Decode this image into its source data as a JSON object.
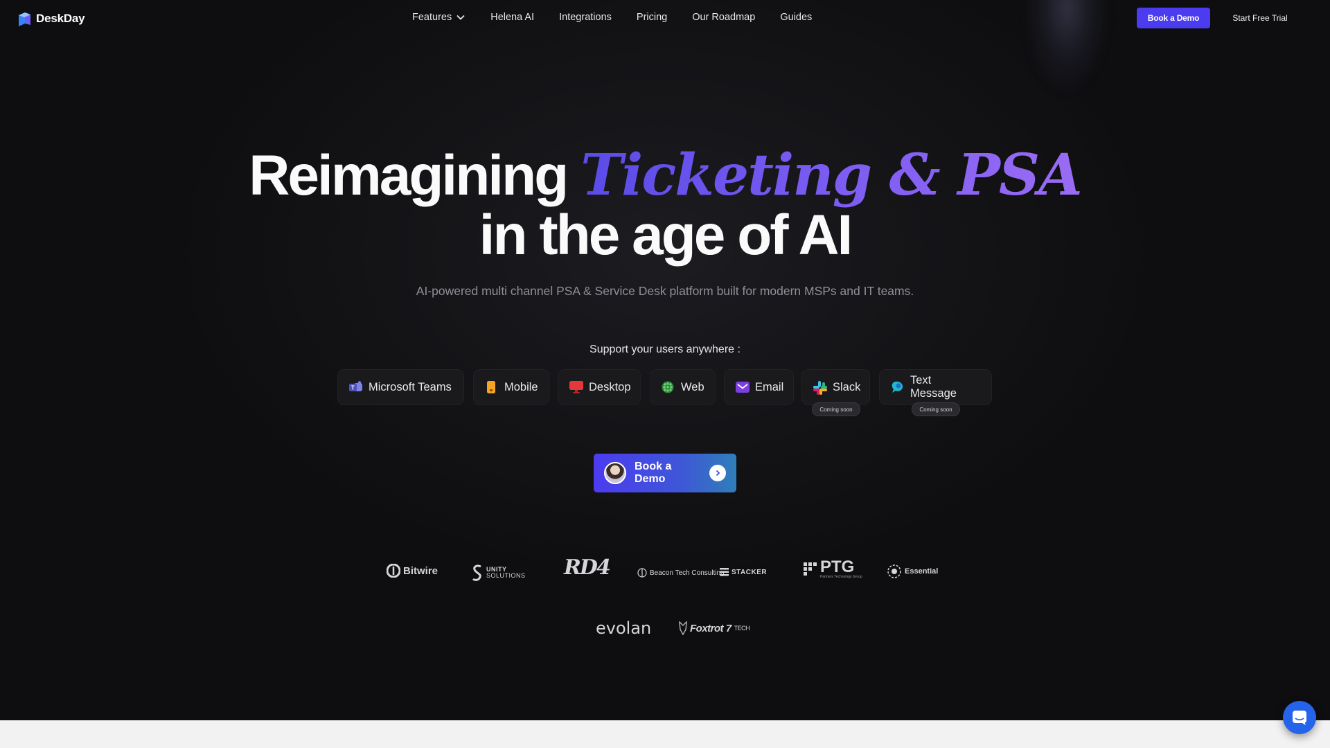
{
  "brand": {
    "name": "DeskDay"
  },
  "nav": {
    "links": [
      {
        "label": "Features"
      },
      {
        "label": "Helena AI"
      },
      {
        "label": "Integrations"
      },
      {
        "label": "Pricing"
      },
      {
        "label": "Our Roadmap"
      },
      {
        "label": "Guides"
      }
    ],
    "book_demo": "Book a Demo",
    "start_trial": "Start Free Trial"
  },
  "hero": {
    "headline_part1": "Reimagining",
    "headline_accent": "Ticketing & PSA",
    "headline_line2": "in the age of AI",
    "subtitle": "AI-powered multi channel PSA & Service Desk platform built for modern MSPs and IT teams.",
    "support_label": "Support your users anywhere :"
  },
  "channels": [
    {
      "label": "Microsoft Teams",
      "icon": "microsoft-teams-icon",
      "color": "#5b5fc7"
    },
    {
      "label": "Mobile",
      "icon": "mobile-icon",
      "color": "#f5a524"
    },
    {
      "label": "Desktop",
      "icon": "desktop-icon",
      "color": "#e5383b"
    },
    {
      "label": "Web",
      "icon": "web-icon",
      "color": "#3fa34d"
    },
    {
      "label": "Email",
      "icon": "email-icon",
      "color": "#7b3fe4"
    },
    {
      "label": "Slack",
      "icon": "slack-icon",
      "badge": "Coming soon"
    },
    {
      "label": "Text Message",
      "icon": "text-message-icon",
      "color": "#22b8cf",
      "badge": "Coming soon"
    }
  ],
  "cta": {
    "label": "Book a Demo"
  },
  "client_logos": {
    "bitwire": "Bitwire",
    "unity_top": "UNITY",
    "unity_bottom": "SOLUTIONS",
    "rd4": "RD4",
    "beacon": "Beacon Tech Consulting",
    "stacker": "STACKER",
    "ptg": "PTG",
    "ptg_sub": "Partners Technology Group",
    "essential": "Essential",
    "evolan": "evolan",
    "foxtrot": "Foxtrot 7",
    "foxtrot_tech": "TECH"
  },
  "colors": {
    "accent": "#4b3cf0",
    "headline_gradient": [
      "#5a4be8",
      "#9a6cf5"
    ],
    "chat_button": "#2563eb"
  }
}
